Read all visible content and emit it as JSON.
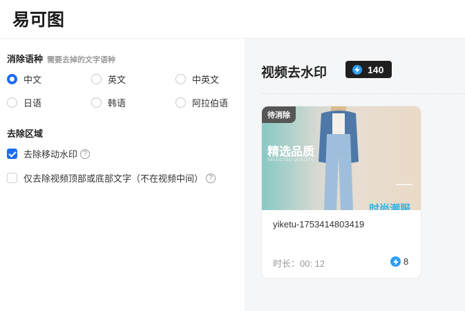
{
  "header": {
    "logo_text": "易可图"
  },
  "settings": {
    "language_section": {
      "title": "消除语种",
      "hint": "需要去掉的文字语种"
    },
    "languages": [
      {
        "label": "中文",
        "selected": true
      },
      {
        "label": "英文",
        "selected": false
      },
      {
        "label": "中英文",
        "selected": false
      },
      {
        "label": "日语",
        "selected": false
      },
      {
        "label": "韩语",
        "selected": false
      },
      {
        "label": "阿拉伯语",
        "selected": false
      }
    ],
    "region_section": {
      "title": "去除区域"
    },
    "options": [
      {
        "label": "去除移动水印",
        "checked": true
      },
      {
        "label": "仅去除视频顶部或底部文字（不在视频中间）",
        "checked": false
      }
    ],
    "help_glyph": "?"
  },
  "panel": {
    "title": "视频去水印",
    "credits": "140",
    "card": {
      "status_tag": "待消除",
      "watermark_main": "精选品质",
      "watermark_sub": "SELECTED QUALITY",
      "watermark_bottom": "时尚潮服",
      "name": "yiketu-1753414803419",
      "duration": "时长：00: 12",
      "cost": "8"
    }
  },
  "colors": {
    "accent": "#1d6cf0",
    "bolt": "#2a9df4",
    "badge_bg": "#1f1f1f"
  }
}
